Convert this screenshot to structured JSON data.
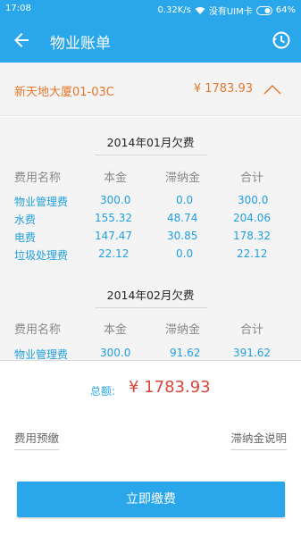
{
  "status_bar": {
    "time": "17:08",
    "speed": "0.32K/s",
    "carrier": "没有UIM卡",
    "battery": "64%"
  },
  "app_bar": {
    "title": "物业账单"
  },
  "property": {
    "address": "新天地大厦01-03C",
    "amount": "¥ 1783.93"
  },
  "bill": {
    "columns": [
      "费用名称",
      "本金",
      "滞纳金",
      "合计"
    ],
    "months": [
      {
        "title": "2014年01月欠费",
        "rows": [
          [
            "物业管理费",
            "300.0",
            "0.0",
            "300.0"
          ],
          [
            "水费",
            "155.32",
            "48.74",
            "204.06"
          ],
          [
            "电费",
            "147.47",
            "30.85",
            "178.32"
          ],
          [
            "垃圾处理费",
            "22.12",
            "0.0",
            "22.12"
          ]
        ]
      },
      {
        "title": "2014年02月欠费",
        "rows": [
          [
            "物业管理费",
            "300.0",
            "91.62",
            "391.62"
          ]
        ]
      }
    ]
  },
  "summary": {
    "total_label": "总额:",
    "total_value": "¥ 1783.93"
  },
  "links": {
    "prepay": "费用预缴",
    "late_fee_info": "滞纳金说明"
  },
  "pay_button": "立即缴费",
  "colors": {
    "primary": "#2aa6ea",
    "address_orange": "#e8762c",
    "total_red": "#d9463a"
  }
}
